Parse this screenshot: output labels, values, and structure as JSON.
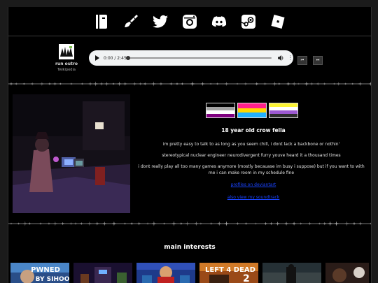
{
  "nav": {
    "icons": [
      "tumblr-book-icon",
      "paintbrush-icon",
      "twitter-icon",
      "instagram-icon",
      "discord-icon",
      "steam-icon",
      "roblox-icon"
    ]
  },
  "music": {
    "title": "run outro",
    "artist": "Twikipedia",
    "time": "0:00 / 2:45",
    "progress": 0.0,
    "prev_label": "⏮",
    "next_label": "⏭"
  },
  "about": {
    "flags": [
      {
        "name": "asexual-flag",
        "colors": [
          "#000000",
          "#a3a3a3",
          "#ffffff",
          "#800080"
        ]
      },
      {
        "name": "pansexual-flag",
        "colors": [
          "#ff218c",
          "#ffd800",
          "#21b1ff"
        ]
      },
      {
        "name": "nonbinary-flag",
        "colors": [
          "#fcf434",
          "#ffffff",
          "#9c59d1",
          "#2c2c2c"
        ]
      }
    ],
    "title": "18 year old crow fella",
    "line1": "im pretty easy to talk to as long as you seem chill, i dont lack a backbone or nothin'",
    "line2": "stereotypical nuclear engineer neurodivergent furry youve heard it a thousand times",
    "line3": "i dont really play all too many games anymore (mostly becauase im busy i suppose) but if you want to with me i can make room in my schedule fine",
    "link1": "profiles on deviantart",
    "link2": "also view my soundtrack"
  },
  "interests": {
    "title": "main interests",
    "tiles": [
      {
        "name": "interest-tile-pwned",
        "label": "PWNED BY SIHOO"
      },
      {
        "name": "interest-tile-robot",
        "label": ""
      },
      {
        "name": "interest-tile-hero",
        "label": ""
      },
      {
        "name": "interest-tile-left4dead2",
        "label": "LEFT 4 DEAD 2"
      },
      {
        "name": "interest-tile-dark",
        "label": ""
      },
      {
        "name": "interest-tile-last",
        "label": ""
      }
    ]
  },
  "colors": {
    "background": "#000000",
    "frame": "#1b1b1b",
    "link": "#1a44ff"
  }
}
